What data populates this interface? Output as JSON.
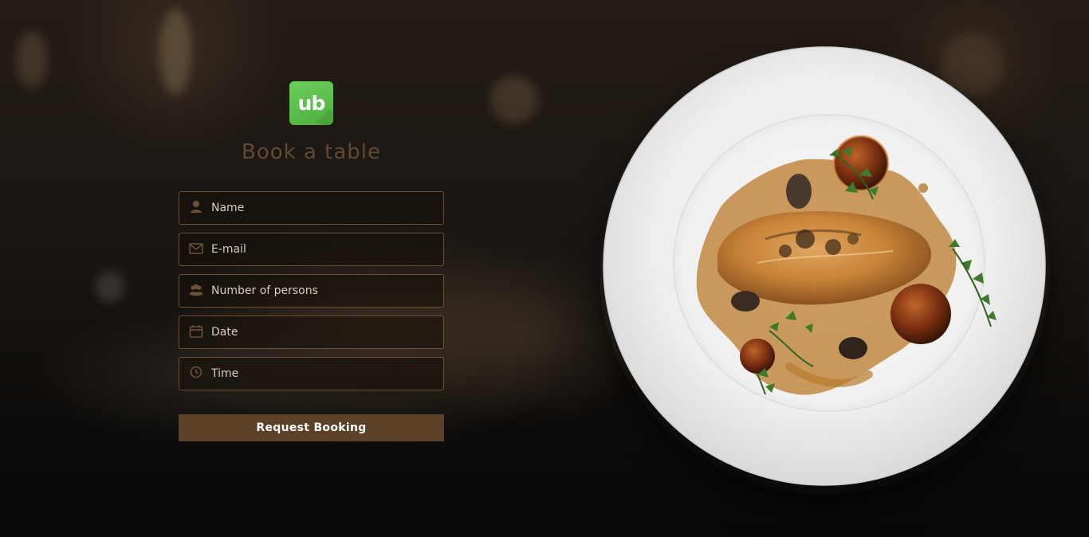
{
  "brand": {
    "logo_text": "ub",
    "logo_color": "#5cc04a"
  },
  "page": {
    "title": "Book a table"
  },
  "form": {
    "name_placeholder": "Name",
    "email_placeholder": "E-mail",
    "persons_placeholder": "Number of persons",
    "date_placeholder": "Date",
    "time_placeholder": "Time",
    "submit_label": "Request Booking",
    "icons": [
      "user-icon",
      "envelope-icon",
      "users-icon",
      "calendar-icon",
      "clock-icon"
    ],
    "accent_color": "#5a4128"
  },
  "hero": {
    "image": "plated-chicken-dish"
  }
}
